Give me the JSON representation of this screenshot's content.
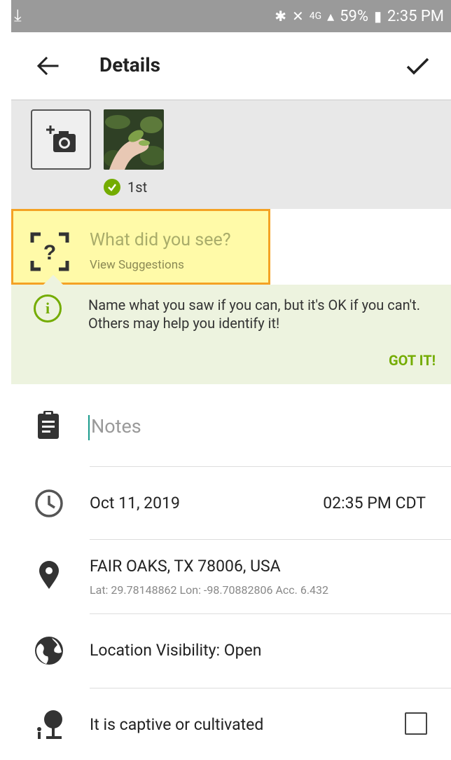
{
  "status_bar": {
    "download_icon": "download-arrow-icon",
    "battery": "59%",
    "time": "2:35 PM",
    "network": "4G"
  },
  "toolbar": {
    "title": "Details"
  },
  "photos": {
    "first_label": "1st"
  },
  "species": {
    "placeholder": "What did you see?",
    "suggestions_link": "View Suggestions"
  },
  "tip": {
    "message": "Name what you saw if you can, but it's OK if you can't. Others may help you identify it!",
    "dismiss_label": "GOT IT!"
  },
  "notes": {
    "placeholder": "Notes"
  },
  "observation": {
    "date": "Oct 11, 2019",
    "time": "02:35 PM CDT"
  },
  "location": {
    "place": "FAIR OAKS, TX 78006, USA",
    "coords": "Lat: 29.78148862 Lon: -98.70882806 Acc. 6.432"
  },
  "visibility": {
    "label": "Location Visibility: Open"
  },
  "captive": {
    "label": "It is captive or cultivated",
    "checked": false
  },
  "colors": {
    "accent_green": "#74ac00",
    "highlight_yellow": "#fffaa8",
    "highlight_border": "#f4a225",
    "tip_background": "#edf3df",
    "cursor_teal": "#1a9b8c"
  }
}
